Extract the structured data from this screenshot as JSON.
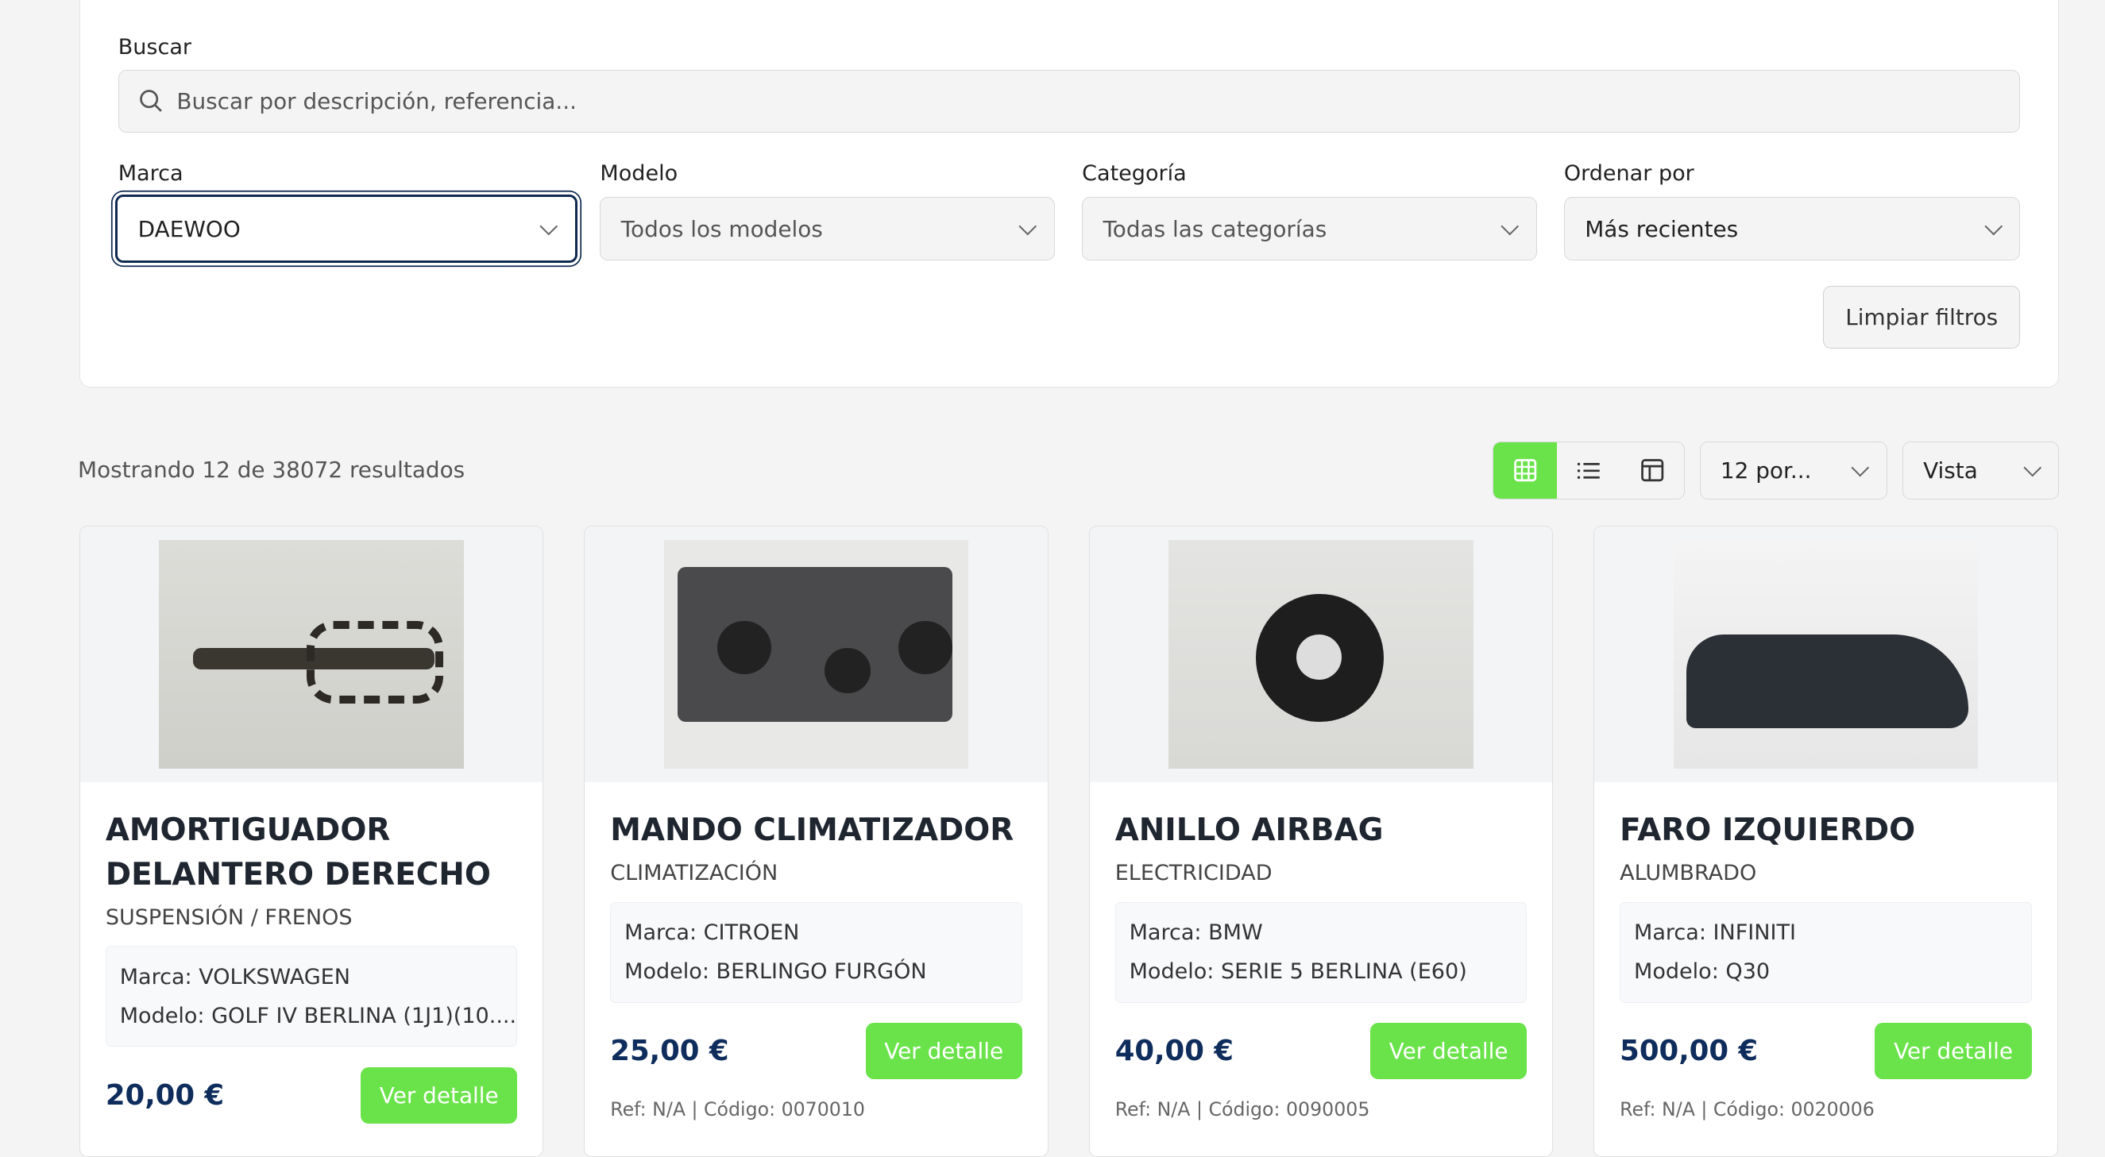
{
  "filters": {
    "search_label": "Buscar",
    "search_placeholder": "Buscar por descripción, referencia...",
    "marca_label": "Marca",
    "marca_value": "DAEWOO",
    "modelo_label": "Modelo",
    "modelo_value": "Todos los modelos",
    "categoria_label": "Categoría",
    "categoria_value": "Todas las categorías",
    "orden_label": "Ordenar por",
    "orden_value": "Más recientes",
    "clear_label": "Limpiar filtros"
  },
  "toolbar": {
    "results_text": "Mostrando 12 de 38072 resultados",
    "per_page": "12 por...",
    "view": "Vista",
    "active_view": "grid",
    "accent": "#6ae34a"
  },
  "products": [
    {
      "title": "AMORTIGUADOR DELANTERO DERECHO",
      "category": "SUSPENSIÓN / FRENOS",
      "marca": "Marca: VOLKSWAGEN",
      "modelo": "Modelo: GOLF IV BERLINA (1J1)(10....",
      "price": "20,00 €",
      "button": "Ver detalle",
      "ref": ""
    },
    {
      "title": "MANDO CLIMATIZADOR",
      "category": "CLIMATIZACIÓN",
      "marca": "Marca: CITROEN",
      "modelo": "Modelo: BERLINGO FURGÓN",
      "price": "25,00 €",
      "button": "Ver detalle",
      "ref": "Ref: N/A | Código: 0070010"
    },
    {
      "title": "ANILLO AIRBAG",
      "category": "ELECTRICIDAD",
      "marca": "Marca: BMW",
      "modelo": "Modelo: SERIE 5 BERLINA (E60)",
      "price": "40,00 €",
      "button": "Ver detalle",
      "ref": "Ref: N/A | Código: 0090005"
    },
    {
      "title": "FARO IZQUIERDO",
      "category": "ALUMBRADO",
      "marca": "Marca: INFINITI",
      "modelo": "Modelo: Q30",
      "price": "500,00 €",
      "button": "Ver detalle",
      "ref": "Ref: N/A | Código: 0020006"
    }
  ]
}
